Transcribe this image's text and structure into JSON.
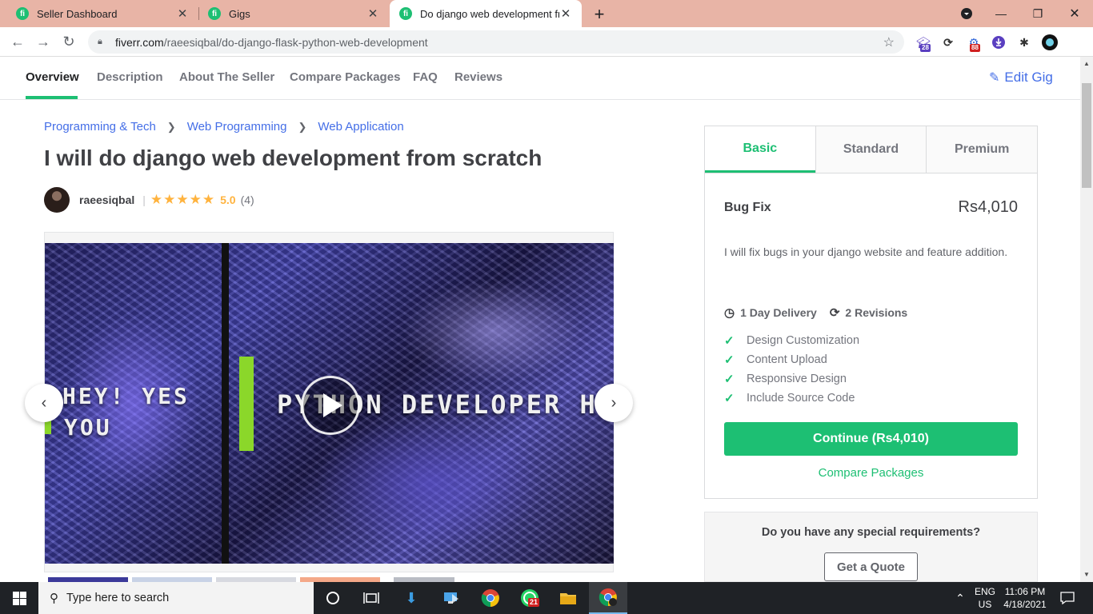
{
  "browser": {
    "tabs": [
      {
        "favicon": "fi",
        "label": "Seller Dashboard",
        "close": "✕"
      },
      {
        "favicon": "fi",
        "label": "Gigs",
        "close": "✕"
      },
      {
        "favicon": "fi",
        "label": "Do django web development fro",
        "close": "✕"
      }
    ],
    "new_tab": "+",
    "window_controls": {
      "minimize": "—",
      "maximize": "❐",
      "close": "✕"
    },
    "url_host": "fiverr.com",
    "url_path": "/raeesiqbal/do-django-flask-python-web-development",
    "extension_badges": {
      "ext1": "28",
      "ext2": "88"
    }
  },
  "gig_nav": {
    "items": [
      "Overview",
      "Description",
      "About The Seller",
      "Compare Packages",
      "FAQ",
      "Reviews"
    ],
    "active_index": 0,
    "edit_label": "Edit Gig"
  },
  "breadcrumb": [
    "Programming & Tech",
    "Web Programming",
    "Web Application"
  ],
  "gig": {
    "title": "I will do django web development from scratch",
    "seller": "raeesiqbal",
    "stars": "★★★★★",
    "rating": "5.0",
    "reviews": "(4)"
  },
  "video": {
    "left_line1": "HEY! YES",
    "left_line2": "YOU",
    "right_text": "PYTHON DEVELOPER HERE"
  },
  "package": {
    "tabs": [
      "Basic",
      "Standard",
      "Premium"
    ],
    "active_tab": "Basic",
    "name": "Bug Fix",
    "price": "Rs4,010",
    "description": "I will fix bugs in your django website and feature addition.",
    "delivery": "1 Day Delivery",
    "revisions": "2 Revisions",
    "features": [
      "Design Customization",
      "Content Upload",
      "Responsive Design",
      "Include Source Code"
    ],
    "continue_label": "Continue (Rs4,010)",
    "compare_label": "Compare Packages"
  },
  "quote": {
    "question": "Do you have any special requirements?",
    "button": "Get a Quote"
  },
  "taskbar": {
    "search_placeholder": "Type here to search",
    "whatsapp_badge": "21",
    "lang_line1": "ENG",
    "lang_line2": "US",
    "time": "11:06 PM",
    "date": "4/18/2021"
  },
  "colors": {
    "brand_green": "#1dbf73",
    "link_blue": "#446ee7",
    "star": "#ffb33e",
    "chrome_tabbar": "#e8b4a6"
  }
}
